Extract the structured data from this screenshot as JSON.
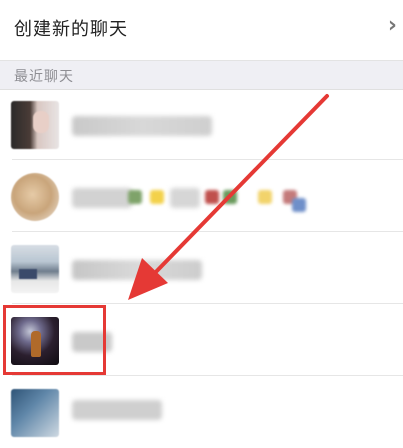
{
  "create_chat": {
    "label": "创建新的聊天",
    "chevron_icon": "chevron-right-icon"
  },
  "recent_section": {
    "label": "最近聊天"
  },
  "recent_chats": [
    {
      "avatar_icon": "contact-avatar-1"
    },
    {
      "avatar_icon": "contact-avatar-2"
    },
    {
      "avatar_icon": "contact-avatar-3"
    },
    {
      "avatar_icon": "contact-avatar-4",
      "highlighted": true
    },
    {
      "avatar_icon": "contact-avatar-5"
    }
  ],
  "annotation": {
    "color": "#e53935"
  },
  "colors": {
    "divider": "#e6e6e6",
    "section_bg": "#efeff4",
    "text_primary": "#222222",
    "text_secondary": "#8e8e93"
  }
}
